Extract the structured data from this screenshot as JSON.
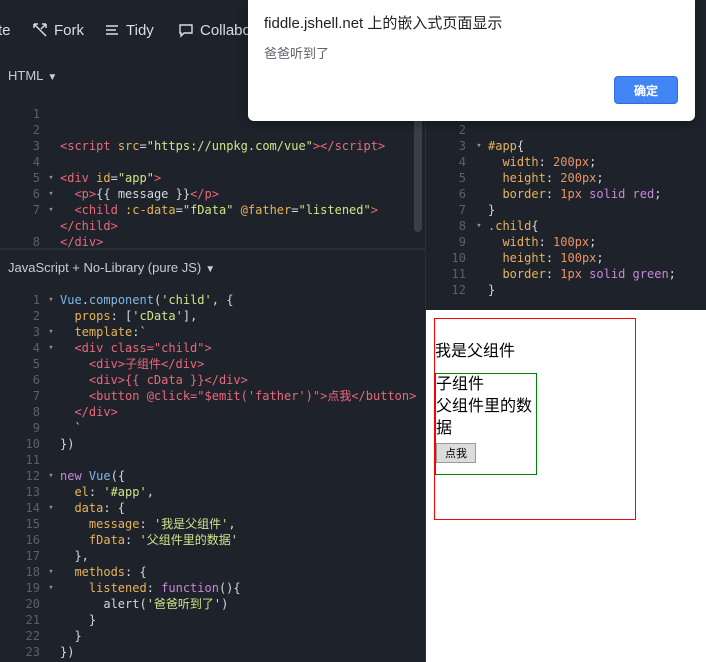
{
  "toolbar": {
    "items": [
      {
        "label": "te",
        "icon": "save-icon"
      },
      {
        "label": "Fork",
        "icon": "fork-icon"
      },
      {
        "label": "Tidy",
        "icon": "tidy-icon"
      },
      {
        "label": "Collabo",
        "icon": "chat-icon"
      }
    ]
  },
  "panels": {
    "html_label": "HTML",
    "js_label": "JavaScript + No-Library (pure JS)"
  },
  "html_code": [
    {
      "n": "1",
      "fold": "",
      "html": ""
    },
    {
      "n": "2",
      "fold": "",
      "html": ""
    },
    {
      "n": "3",
      "fold": "",
      "html": "<span class='t-tag'>&lt;script</span> <span class='t-attr'>src</span>=<span class='t-str'>\"https://unpkg.com/vue\"</span><span class='t-tag'>&gt;&lt;/script&gt;</span>"
    },
    {
      "n": "4",
      "fold": "",
      "html": ""
    },
    {
      "n": "5",
      "fold": "▾",
      "html": "<span class='t-tag'>&lt;div</span> <span class='t-attr'>id</span>=<span class='t-str'>\"app\"</span><span class='t-tag'>&gt;</span>"
    },
    {
      "n": "6",
      "fold": "▾",
      "html": "  <span class='t-tag'>&lt;p&gt;</span>{{ message }}<span class='t-tag'>&lt;/p&gt;</span>"
    },
    {
      "n": "7",
      "fold": "▾",
      "html": "  <span class='t-tag'>&lt;child</span> <span class='t-attr'>:c-data</span>=<span class='t-str'>\"fData\"</span> <span class='t-attr'>@father</span>=<span class='t-str'>\"listened\"</span><span class='t-tag'>&gt;</span>"
    },
    {
      "n": "",
      "fold": "",
      "html": "<span class='t-tag'>&lt;/child&gt;</span>"
    },
    {
      "n": "8",
      "fold": "",
      "html": "<span class='t-tag'>&lt;/div&gt;</span>"
    }
  ],
  "css_code": [
    {
      "n": "2",
      "fold": "",
      "html": ""
    },
    {
      "n": "3",
      "fold": "▾",
      "html": "<span class='t-sel'>#app</span>{"
    },
    {
      "n": "4",
      "fold": "",
      "html": "  <span class='t-prop'>width</span>: <span class='t-num'>200px</span>;"
    },
    {
      "n": "5",
      "fold": "",
      "html": "  <span class='t-prop'>height</span>: <span class='t-num'>200px</span>;"
    },
    {
      "n": "6",
      "fold": "",
      "html": "  <span class='t-prop'>border</span>: <span class='t-num'>1px</span> <span class='t-kw'>solid</span> <span class='t-kw'>red</span>;"
    },
    {
      "n": "7",
      "fold": "",
      "html": "}"
    },
    {
      "n": "8",
      "fold": "▾",
      "html": "<span class='t-sel'>.child</span>{"
    },
    {
      "n": "9",
      "fold": "",
      "html": "  <span class='t-prop'>width</span>: <span class='t-num'>100px</span>;"
    },
    {
      "n": "10",
      "fold": "",
      "html": "  <span class='t-prop'>height</span>: <span class='t-num'>100px</span>;"
    },
    {
      "n": "11",
      "fold": "",
      "html": "  <span class='t-prop'>border</span>: <span class='t-num'>1px</span> <span class='t-kw'>solid</span> <span class='t-kw'>green</span>;"
    },
    {
      "n": "12",
      "fold": "",
      "html": "}"
    }
  ],
  "js_code": [
    {
      "n": "1",
      "fold": "▾",
      "html": "<span class='t-fn'>Vue</span>.<span class='t-fn'>component</span>(<span class='t-str'>'child'</span>, {"
    },
    {
      "n": "2",
      "fold": "",
      "html": "  <span class='t-prop'>props</span>: [<span class='t-str'>'cData'</span>],"
    },
    {
      "n": "3",
      "fold": "▾",
      "html": "  <span class='t-prop'>template</span>:<span class='t-str'>`</span>"
    },
    {
      "n": "4",
      "fold": "▾",
      "html": "  <span class='t-tag'>&lt;div class=\"child\"&gt;</span>"
    },
    {
      "n": "5",
      "fold": "",
      "html": "    <span class='t-tag'>&lt;div&gt;子组件&lt;/div&gt;</span>"
    },
    {
      "n": "6",
      "fold": "",
      "html": "    <span class='t-tag'>&lt;div&gt;{{ cData }}&lt;/div&gt;</span>"
    },
    {
      "n": "7",
      "fold": "",
      "html": "    <span class='t-tag'>&lt;button @click=\"$emit('father')\"&gt;点我&lt;/button&gt;</span>"
    },
    {
      "n": "8",
      "fold": "",
      "html": "  <span class='t-tag'>&lt;/div&gt;</span>"
    },
    {
      "n": "9",
      "fold": "",
      "html": "  <span class='t-str'>`</span>"
    },
    {
      "n": "10",
      "fold": "",
      "html": "})"
    },
    {
      "n": "11",
      "fold": "",
      "html": ""
    },
    {
      "n": "12",
      "fold": "▾",
      "html": "<span class='t-kw'>new</span> <span class='t-fn'>Vue</span>({"
    },
    {
      "n": "13",
      "fold": "",
      "html": "  <span class='t-prop'>el</span>: <span class='t-str'>'#app'</span>,"
    },
    {
      "n": "14",
      "fold": "▾",
      "html": "  <span class='t-prop'>data</span>: {"
    },
    {
      "n": "15",
      "fold": "",
      "html": "    <span class='t-prop'>message</span>: <span class='t-str'>'我是父组件'</span>,"
    },
    {
      "n": "16",
      "fold": "",
      "html": "    <span class='t-prop'>fData</span>: <span class='t-str'>'父组件里的数据'</span>"
    },
    {
      "n": "17",
      "fold": "",
      "html": "  },"
    },
    {
      "n": "18",
      "fold": "▾",
      "html": "  <span class='t-prop'>methods</span>: {"
    },
    {
      "n": "19",
      "fold": "▾",
      "html": "    <span class='t-prop'>listened</span>: <span class='t-kw'>function</span>(){"
    },
    {
      "n": "20",
      "fold": "",
      "html": "      alert(<span class='t-str'>'爸爸听到了'</span>)"
    },
    {
      "n": "21",
      "fold": "",
      "html": "    }"
    },
    {
      "n": "22",
      "fold": "",
      "html": "  }"
    },
    {
      "n": "23",
      "fold": "",
      "html": "})"
    }
  ],
  "dialog": {
    "title": "fiddle.jshell.net 上的嵌入式页面显示",
    "message": "爸爸听到了",
    "ok_label": "确定"
  },
  "result": {
    "parent_message": "我是父组件",
    "child_title": "子组件",
    "child_data": "父组件里的数据",
    "button_label": "点我"
  }
}
